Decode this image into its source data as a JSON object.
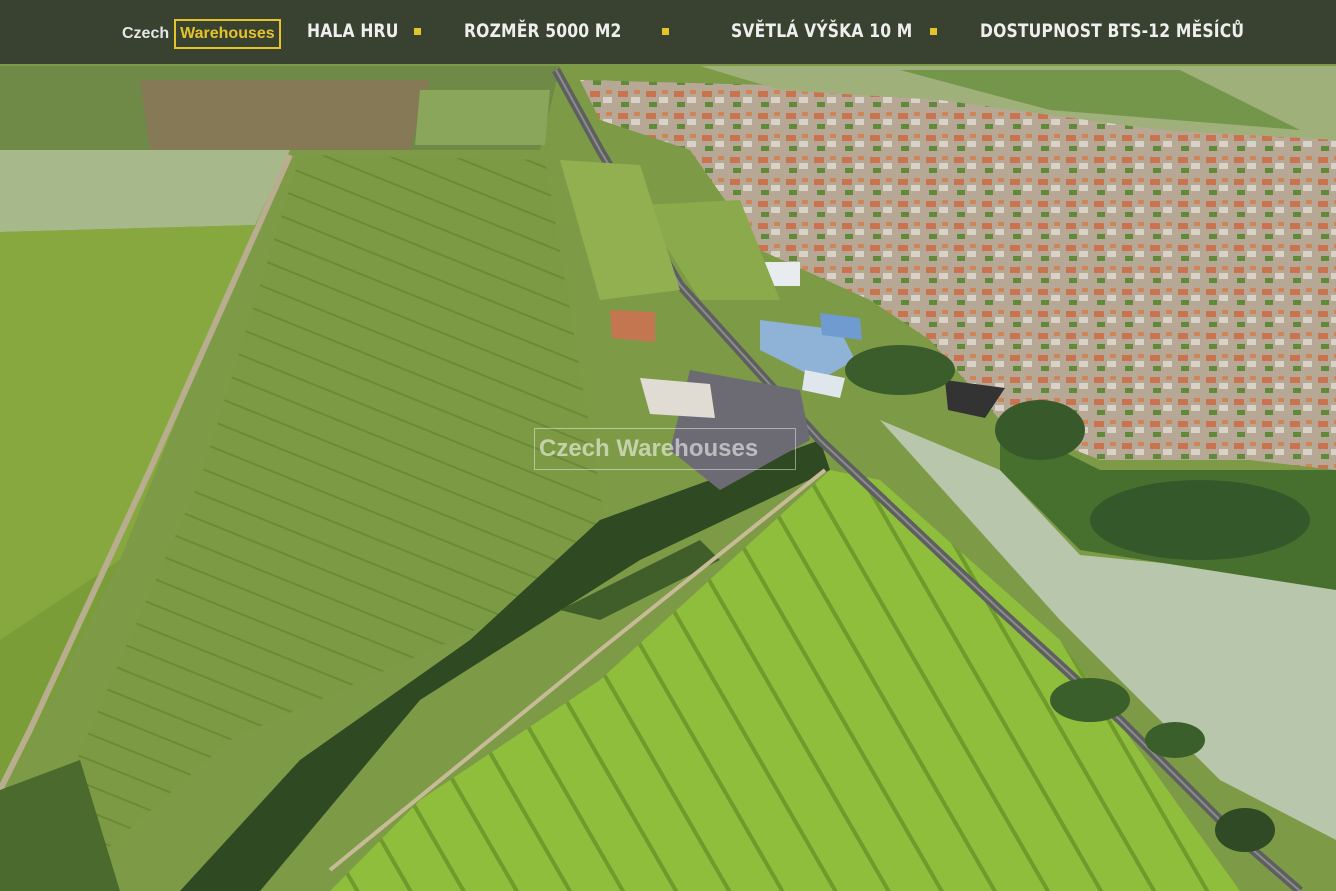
{
  "brand": {
    "prefix": "Czech",
    "name": "Warehouses"
  },
  "nav": {
    "items": [
      {
        "label": "HALA  HRU"
      },
      {
        "label": "ROZMĚR 5000 M2"
      },
      {
        "label": "SVĚTLÁ VÝŠKA  10 M"
      },
      {
        "label": "DOSTUPNOST BTS-12 MĚSÍCŮ"
      }
    ]
  },
  "watermark": {
    "text": "Czech Warehouses"
  },
  "colors": {
    "accent": "#e5c42a",
    "topbar": "#26282a"
  }
}
